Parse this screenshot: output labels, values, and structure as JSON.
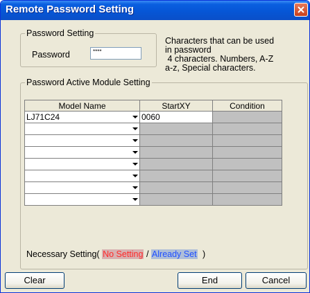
{
  "window": {
    "title": "Remote Password Setting"
  },
  "password_setting": {
    "group_label": "Password Setting",
    "password_label": "Password",
    "password_value": "****",
    "info_lines": [
      "Characters that can be used",
      "in password",
      " 4 characters. Numbers, A-Z",
      "a-z, Special characters."
    ]
  },
  "module_setting": {
    "group_label": "Password Active Module Setting",
    "columns": [
      "Model Name",
      "StartXY",
      "Condition"
    ],
    "rows": [
      {
        "model": "LJ71C24",
        "start": "0060",
        "condition": ""
      },
      {
        "model": "",
        "start": "",
        "condition": ""
      },
      {
        "model": "",
        "start": "",
        "condition": ""
      },
      {
        "model": "",
        "start": "",
        "condition": ""
      },
      {
        "model": "",
        "start": "",
        "condition": ""
      },
      {
        "model": "",
        "start": "",
        "condition": ""
      },
      {
        "model": "",
        "start": "",
        "condition": ""
      },
      {
        "model": "",
        "start": "",
        "condition": ""
      }
    ]
  },
  "legend": {
    "prefix": "Necessary Setting(",
    "no_setting": "No Setting",
    "separator": "/",
    "already_set": "Already Set",
    "suffix": ")"
  },
  "buttons": {
    "clear": "Clear",
    "end": "End",
    "cancel": "Cancel"
  }
}
